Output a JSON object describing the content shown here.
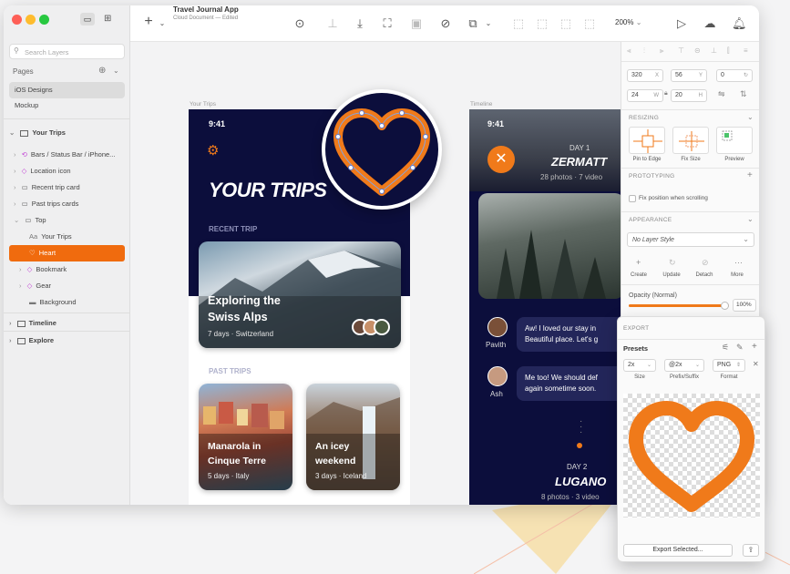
{
  "window": {
    "title": "Travel Journal App",
    "subtitle": "Cloud Document — Edited",
    "zoom": "200%"
  },
  "sidebar": {
    "search_placeholder": "Search Layers",
    "pages_label": "Pages",
    "pages": [
      "iOS Designs",
      "Mockup"
    ],
    "layers": [
      {
        "label": "Your Trips"
      },
      {
        "label": "Bars / Status Bar / iPhone..."
      },
      {
        "label": "Location icon"
      },
      {
        "label": "Recent trip card"
      },
      {
        "label": "Past trips cards"
      },
      {
        "label": "Top"
      },
      {
        "label": "Your Trips"
      },
      {
        "label": "Heart"
      },
      {
        "label": "Bookmark"
      },
      {
        "label": "Gear"
      },
      {
        "label": "Background"
      },
      {
        "label": "Timeline"
      },
      {
        "label": "Explore"
      }
    ]
  },
  "canvas": {
    "artboard1_label": "Your Trips",
    "artboard2_label": "Timeline",
    "time": "9:41",
    "title": "YOUR TRIPS",
    "recent_trip_label": "RECENT TRIP",
    "recent_card_title1": "Exploring the",
    "recent_card_title2": "Swiss Alps",
    "recent_card_meta": "7 days · Switzerland",
    "past_trips_label": "PAST TRIPS",
    "past1_title1": "Manarola in",
    "past1_title2": "Cinque Terre",
    "past1_meta": "5 days · Italy",
    "past2_title1": "An icey",
    "past2_title2": "weekend",
    "past2_meta": "3 days · Iceland",
    "tl_time": "9:41",
    "day1": "DAY 1",
    "day1_city": "ZERMATT",
    "day1_meta": "28 photos · 7 video",
    "chat1_name": "Pavith",
    "chat1_text1": "Aw! I loved our stay in",
    "chat1_text2": "Beautiful place. Let's g",
    "chat2_name": "Ash",
    "chat2_text1": "Me too! We should def",
    "chat2_text2": "again sometime soon.",
    "day2": "DAY 2",
    "day2_city": "LUGANO",
    "day2_meta": "8 photos · 3 video"
  },
  "inspector": {
    "x": "320",
    "x_unit": "X",
    "y": "56",
    "y_unit": "Y",
    "rot": "0",
    "w": "24",
    "w_unit": "W",
    "h": "20",
    "h_unit": "H",
    "resizing_label": "RESIZING",
    "pin_label": "Pin to Edge",
    "fix_label": "Fix Size",
    "preview_label": "Preview",
    "prototyping_label": "PROTOTYPING",
    "fix_position_label": "Fix position when scrolling",
    "appearance_label": "APPEARANCE",
    "layer_style": "No Layer Style",
    "create": "Create",
    "update": "Update",
    "detach": "Detach",
    "more": "More",
    "opacity_label": "Opacity (Normal)",
    "opacity_value": "100%",
    "opacity": 1.0,
    "export_label": "EXPORT",
    "presets_label": "Presets",
    "size_value": "2x",
    "suffix_value": "@2x",
    "format_value": "PNG",
    "size_label": "Size",
    "suffix_label": "Prefix/Suffix",
    "format_label": "Format",
    "export_button": "Export Selected..."
  },
  "colors": {
    "accent": "#f07a1a",
    "navy": "#0c0e3c",
    "selection": "#f06b0e"
  }
}
